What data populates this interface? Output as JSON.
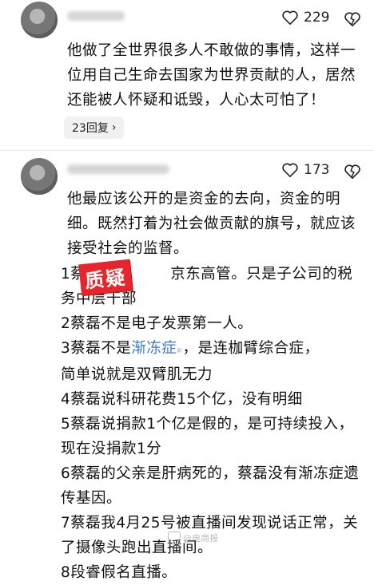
{
  "comment1": {
    "like_count": "229",
    "text": "他做了全世界很多人不敢做的事情，这样一位用自己生命去国家为世界贡献的人，居然还能被人怀疑和诋毁，人心太可怕了！",
    "reply_label": "23回复",
    "reply_chevron": "›"
  },
  "comment2": {
    "like_count": "173",
    "intro": "他最应该公开的是资金的去向，资金的明细。既然打着为社会做贡献的旗号，就应该接受社会的监督。",
    "stamp": "质疑",
    "points": {
      "p1_a": "1蔡",
      "p1_b": "京东高管。只是子公司的税",
      "p1_c": "务中层干部",
      "p2": "2蔡磊不是电子发票第一人。",
      "p3_a": "3蔡磊不是",
      "p3_link": "渐冻症",
      "p3_b": "，是连枷臂综合症，",
      "p3_c": "简单说就是双臂肌无力",
      "p4": "4蔡磊说科研花费15个亿，没有明细",
      "p5": "5蔡磊说捐款1个亿是假的，是可持续投入，现在没捐款1分",
      "p6": "6蔡磊的父亲是肝病死的，蔡磊没有渐冻症遗传基因。",
      "p7": "7蔡磊我4月25号被直播间发现说话正常，关了摄像头跑出直播间。",
      "p8": "8段睿假名直播。"
    }
  },
  "watermark": "@电商报",
  "icons": {
    "like": "heart-outline-icon",
    "more": "dislike-heart-icon",
    "search": "search-icon"
  }
}
